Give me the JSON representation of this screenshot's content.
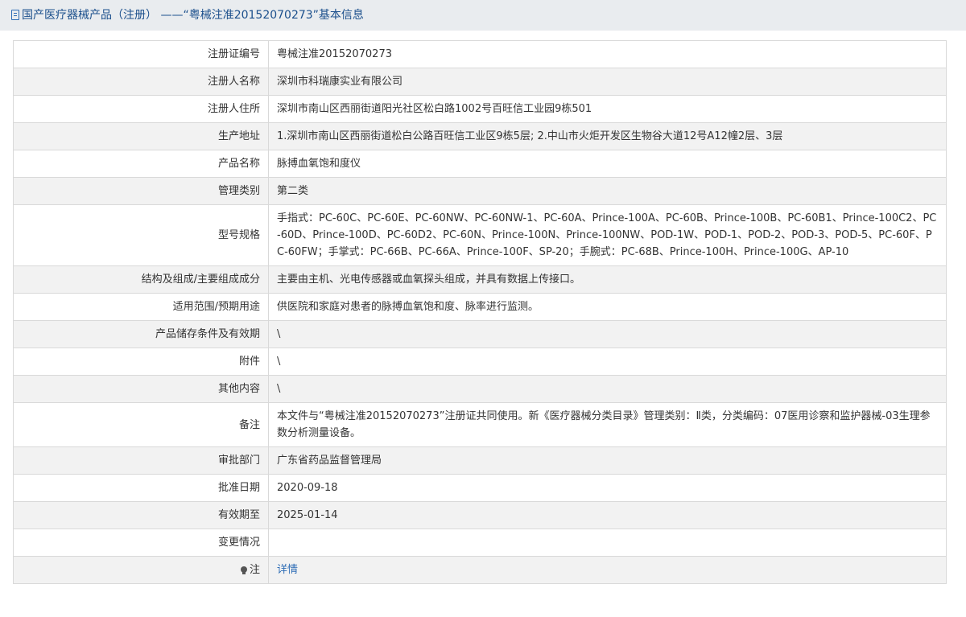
{
  "page": {
    "title": "国产医疗器械产品（注册） ——“粤械注准20152070273”基本信息"
  },
  "rows": [
    {
      "label": "注册证编号",
      "value": "粤械注准20152070273"
    },
    {
      "label": "注册人名称",
      "value": "深圳市科瑞康实业有限公司"
    },
    {
      "label": "注册人住所",
      "value": "深圳市南山区西丽街道阳光社区松白路1002号百旺信工业园9栋501"
    },
    {
      "label": "生产地址",
      "value": "1.深圳市南山区西丽街道松白公路百旺信工业区9栋5层; 2.中山市火炬开发区生物谷大道12号A12幢2层、3层"
    },
    {
      "label": "产品名称",
      "value": "脉搏血氧饱和度仪"
    },
    {
      "label": "管理类别",
      "value": "第二类"
    },
    {
      "label": "型号规格",
      "value": "手指式：PC-60C、PC-60E、PC-60NW、PC-60NW-1、PC-60A、Prince-100A、PC-60B、Prince-100B、PC-60B1、Prince-100C2、PC-60D、Prince-100D、PC-60D2、PC-60N、Prince-100N、Prince-100NW、POD-1W、POD-1、POD-2、POD-3、POD-5、PC-60F、PC-60FW；手掌式：PC-66B、PC-66A、Prince-100F、SP-20；手腕式：PC-68B、Prince-100H、Prince-100G、AP-10"
    },
    {
      "label": "结构及组成/主要组成成分",
      "value": "主要由主机、光电传感器或血氧探头组成，并具有数据上传接口。"
    },
    {
      "label": "适用范围/预期用途",
      "value": "供医院和家庭对患者的脉搏血氧饱和度、脉率进行监测。"
    },
    {
      "label": "产品储存条件及有效期",
      "value": "\\"
    },
    {
      "label": "附件",
      "value": "\\"
    },
    {
      "label": "其他内容",
      "value": "\\"
    },
    {
      "label": "备注",
      "value": "本文件与“粤械注准20152070273”注册证共同使用。新《医疗器械分类目录》管理类别：Ⅱ类，分类编码：07医用诊察和监护器械-03生理参数分析测量设备。"
    },
    {
      "label": "审批部门",
      "value": "广东省药品监督管理局"
    },
    {
      "label": "批准日期",
      "value": "2020-09-18"
    },
    {
      "label": "有效期至",
      "value": "2025-01-14"
    },
    {
      "label": "变更情况",
      "value": ""
    }
  ],
  "note": {
    "label": "注",
    "link_text": "详情",
    "icon": "lightbulb-icon"
  }
}
